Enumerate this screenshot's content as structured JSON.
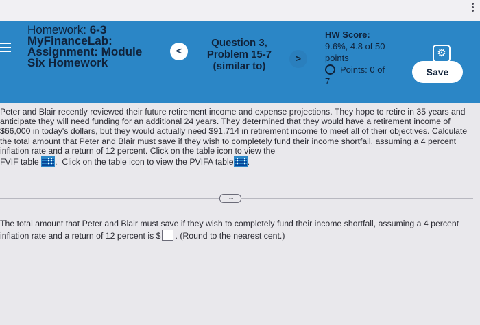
{
  "header": {
    "title_label": "Homework:",
    "title_number": "6-3",
    "course": "MyFinanceLab:",
    "assignment_line1": "Assignment: Module",
    "assignment_line2": "Six Homework",
    "prev_symbol": "<",
    "next_symbol": ">",
    "question_line1": "Question 3,",
    "question_line2": "Problem 15-7",
    "question_line3": "(similar to)",
    "hw_score_label": "HW Score:",
    "hw_score_value_line1": "9.6%, 4.8 of 50",
    "hw_score_value_line2": "points",
    "points_label": "Points: 0 of",
    "points_total": "7",
    "gear_icon": "⚙",
    "save_label": "Save"
  },
  "problem": {
    "text": "Peter and Blair recently reviewed their future retirement income and expense projections. They hope to retire in 35 years and anticipate they will need funding for an additional 24 years. They determined that they would have a retirement income of $66,000 in today's dollars, but they would actually need $91,714 in retirement income to meet all of their objectives. Calculate the total amount that Peter and Blair must save if they wish to completely fund their income shortfall, assuming a 4 percent inflation rate and a return of 12 percent. Click on the table icon to view the",
    "fvif_label": "FVIF table",
    "pvifa_text": "Click on the table icon to view the PVIFA table"
  },
  "expander_label": "....",
  "answer": {
    "text_before": "The total amount that Peter and Blair must save if they wish to completely fund their income shortfall, assuming a 4 percent inflation rate and a return of 12 percent is $",
    "text_after": ". (Round to the nearest cent.)",
    "input_value": ""
  },
  "colors": {
    "header_bg": "#2b86c6",
    "page_bg": "#e9e8ec"
  }
}
